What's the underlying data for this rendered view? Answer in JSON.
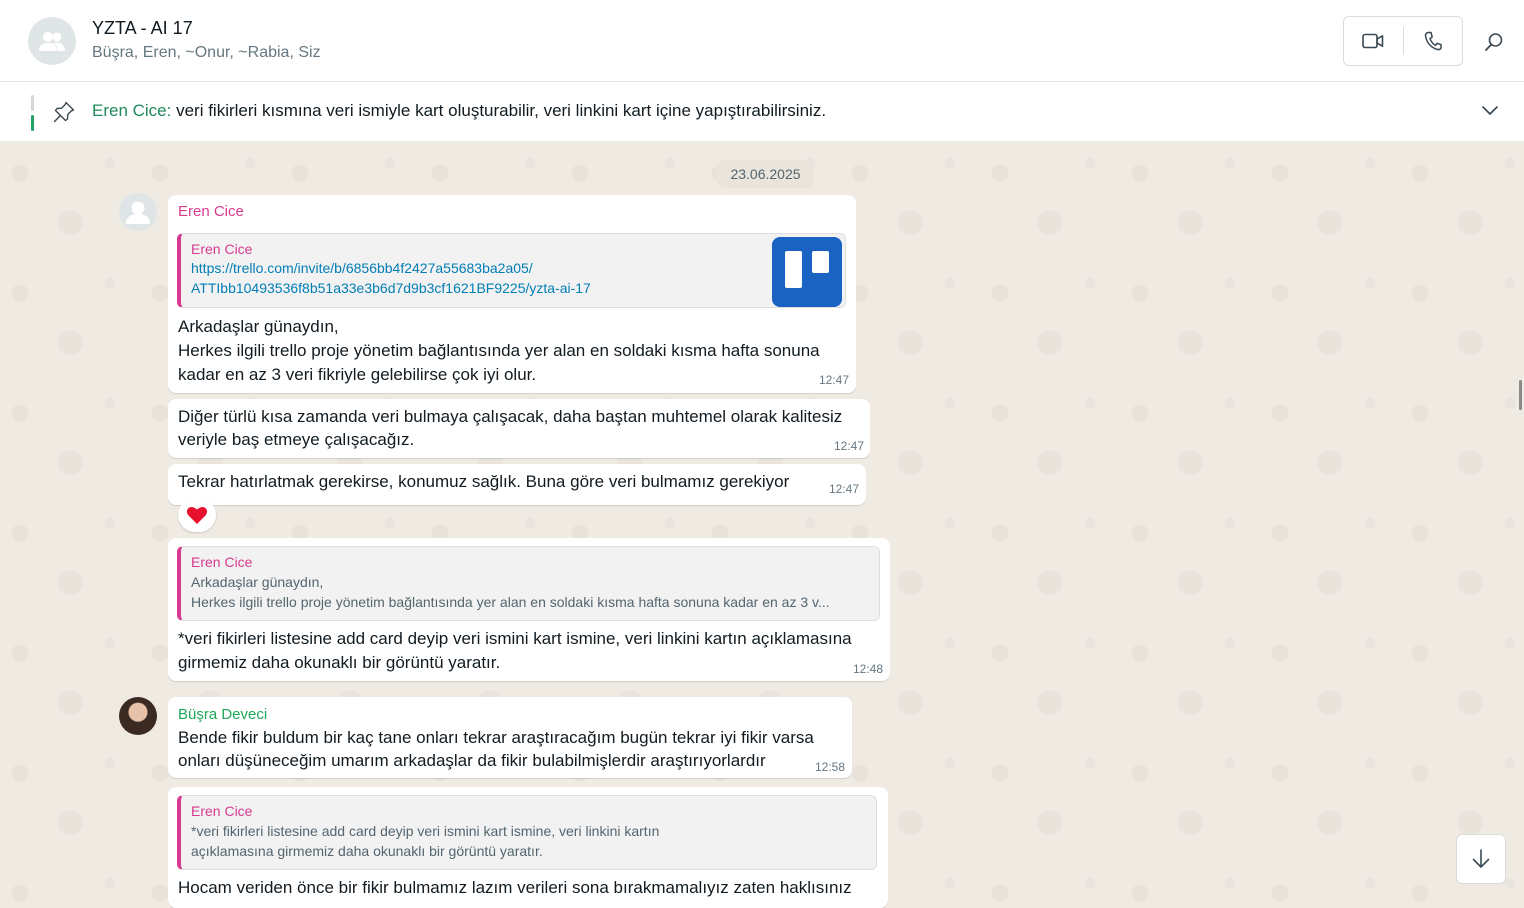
{
  "header": {
    "title": "YZTA - AI 17",
    "members": "Büşra, Eren, ~Onur, ~Rabia, Siz"
  },
  "pinned": {
    "author": "Eren Cice:",
    "text": " veri fikirleri kısmına veri ismiyle kart oluşturabilir, veri linkini kart içine yapıştırabilirsiniz."
  },
  "date": "23.06.2025",
  "messages": [
    {
      "sender": "Eren Cice",
      "link_preview": {
        "author": "Eren Cice",
        "url_line1": "https://trello.com/invite/b/6856bb4f2427a55683ba2a05/",
        "url_line2": "ATTIbb10493536f8b51a33e3b6d7d9b3cf1621BF9225/yzta-ai-17"
      },
      "lines": [
        "Arkadaşlar günaydın,",
        "Herkes ilgili trello proje yönetim bağlantısında yer alan en soldaki kısma hafta sonuna",
        "kadar en az 3 veri fikriyle gelebilirse çok iyi olur."
      ],
      "time": "12:47"
    },
    {
      "lines": [
        "Diğer türlü kısa zamanda veri bulmaya çalışacak, daha baştan muhtemel olarak kalitesiz",
        "veriyle baş etmeye çalışacağız."
      ],
      "time": "12:47"
    },
    {
      "lines": [
        "Tekrar hatırlatmak gerekirse, konumuz sağlık. Buna göre veri bulmamız gerekiyor"
      ],
      "time": "12:47",
      "reaction": "❤️"
    },
    {
      "quote": {
        "author": "Eren Cice",
        "line1": "Arkadaşlar günaydın,",
        "line2": "Herkes ilgili trello proje yönetim bağlantısında yer alan en soldaki kısma hafta sonuna kadar en az 3 v..."
      },
      "lines": [
        "*veri fikirleri listesine add card deyip veri ismini kart ismine, veri linkini kartın açıklamasına",
        "girmemiz daha okunaklı bir görüntü yaratır."
      ],
      "time": "12:48"
    },
    {
      "sender": "Büşra Deveci",
      "lines": [
        "Bende fikir buldum bir kaç tane onları tekrar araştıracağım bugün tekrar iyi fikir varsa",
        "onları düşüneceğim umarım arkadaşlar da fikir bulabilmişlerdir araştırıyorlardır"
      ],
      "time": "12:58"
    },
    {
      "quote": {
        "author": "Eren Cice",
        "line1": "*veri fikirleri listesine add card deyip veri ismini kart ismine, veri linkini kartın",
        "line2": "açıklamasına girmemiz daha okunaklı bir görüntü yaratır."
      },
      "lines": [
        "Hocam veriden önce bir fikir bulmamız lazım verileri  sona bırakmamalıyız zaten haklısınız"
      ]
    }
  ],
  "icons": {
    "video": "video-camera-icon",
    "call": "phone-icon",
    "search": "search-icon",
    "pin": "pin-icon",
    "chevron": "chevron-down-icon",
    "scroll_down": "arrow-down-icon"
  },
  "colors": {
    "eren": "#d63b8f",
    "busra": "#1fa855",
    "pinned_author": "#1f8a5b",
    "link": "#027eb5",
    "trello": "#1a63c3"
  }
}
